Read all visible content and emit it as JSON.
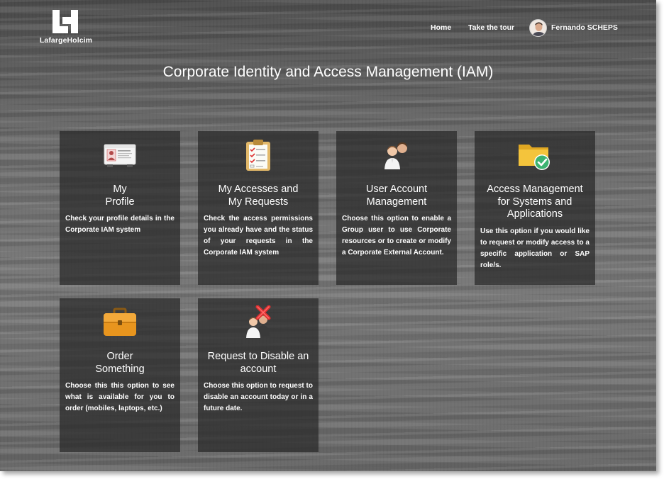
{
  "brand": {
    "name": "LafargeHolcim"
  },
  "nav": {
    "home": "Home",
    "tour": "Take the tour",
    "user_name": "Fernando SCHEPS"
  },
  "page_title": "Corporate Identity and Access Management (IAM)",
  "tiles": [
    {
      "icon": "id-card-icon",
      "title": "My\nProfile",
      "description": "Check your profile details in the Corporate IAM system"
    },
    {
      "icon": "clipboard-checklist-icon",
      "title": "My Accesses and\nMy Requests",
      "description": "Check the access permissions you already have and the status of your requests in the Corporate IAM system"
    },
    {
      "icon": "users-icon",
      "title": "User Account\nManagement",
      "description": "Choose this option to enable a Group user to use Corporate resources or to create or modify a Corporate External Account."
    },
    {
      "icon": "folder-check-icon",
      "title": "Access Management\nfor Systems and\nApplications",
      "description": "Use this option if you would like to request or modify access to a specific application or SAP role/s."
    },
    {
      "icon": "briefcase-icon",
      "title": "Order\nSomething",
      "description": "Choose this this option to see what is available for you to order (mobiles, laptops, etc.)"
    },
    {
      "icon": "users-remove-icon",
      "title": "Request to Disable an\naccount",
      "description": "Choose this option to request to disable an account today or in a future date."
    }
  ],
  "colors": {
    "tile_bg": "#2a2a2a",
    "check_green": "#3cb371",
    "folder_yellow": "#f2c33a",
    "remove_red": "#e03030"
  }
}
